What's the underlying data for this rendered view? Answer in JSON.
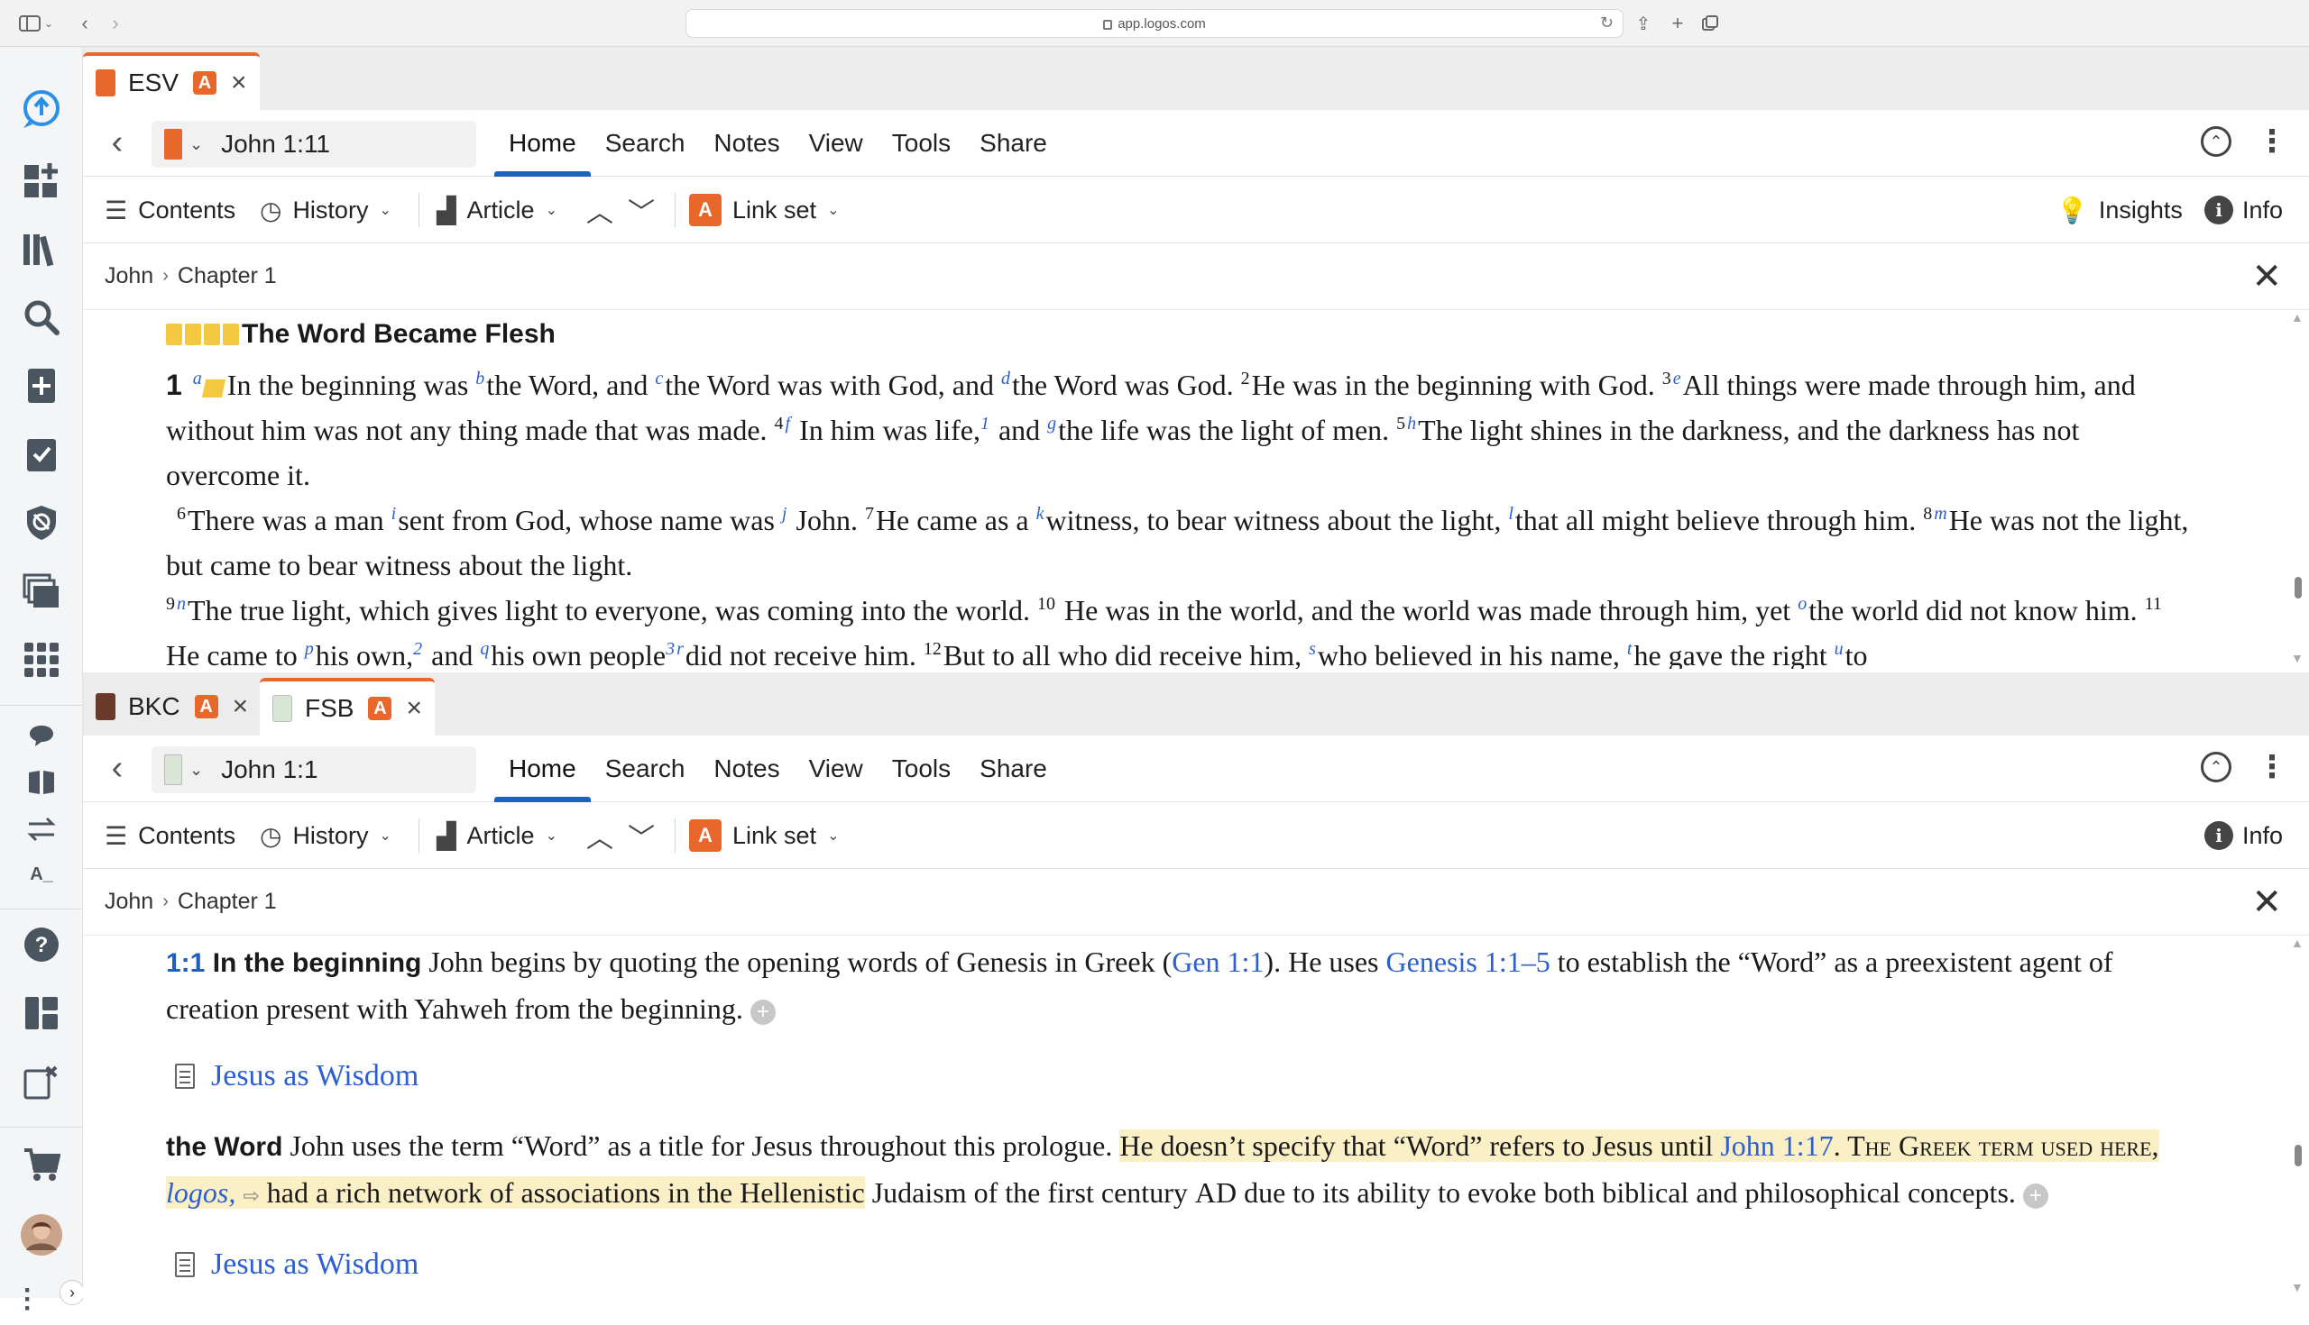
{
  "browser": {
    "url": "app.logos.com"
  },
  "top_pane": {
    "tabs": [
      {
        "label": "ESV",
        "badge": "A",
        "active": true
      }
    ],
    "reference": "John 1:11",
    "menu": [
      "Home",
      "Search",
      "Notes",
      "View",
      "Tools",
      "Share"
    ],
    "toolbar": {
      "contents": "Contents",
      "history": "History",
      "article": "Article",
      "badge": "A",
      "link_set": "Link set",
      "insights": "Insights",
      "info": "Info"
    },
    "breadcrumb": {
      "book": "John",
      "chapter": "Chapter 1"
    },
    "text": {
      "pericope": "The Word Became Flesh",
      "chapter": "1",
      "p1": [
        {
          "t": "fn",
          "v": "a"
        },
        {
          "t": "txt",
          "v": "In the beginning was "
        },
        {
          "t": "fn",
          "v": "b"
        },
        {
          "t": "txt",
          "v": "the Word, and "
        },
        {
          "t": "fn",
          "v": "c"
        },
        {
          "t": "txt",
          "v": "the Word was with God, and "
        },
        {
          "t": "fn",
          "v": "d"
        },
        {
          "t": "txt",
          "v": "the Word was God. "
        },
        {
          "t": "vn",
          "v": "2"
        },
        {
          "t": "txt",
          "v": "He was in the beginning with God. "
        },
        {
          "t": "vn",
          "v": "3"
        },
        {
          "t": "fn",
          "v": "e"
        },
        {
          "t": "txt",
          "v": "All things were made through him, and without him was not any thing made that was made. "
        },
        {
          "t": "vn",
          "v": "4"
        },
        {
          "t": "fn",
          "v": "f"
        },
        {
          "t": "txt",
          "v": " In him was life,"
        },
        {
          "t": "fn",
          "v": "1"
        },
        {
          "t": "txt",
          "v": " and "
        },
        {
          "t": "fn",
          "v": "g"
        },
        {
          "t": "txt",
          "v": "the life was the light of men. "
        },
        {
          "t": "vn",
          "v": "5"
        },
        {
          "t": "fn",
          "v": "h"
        },
        {
          "t": "txt",
          "v": "The light shines in the darkness, and the darkness has not overcome it."
        }
      ],
      "p2": [
        {
          "t": "vn",
          "v": "6"
        },
        {
          "t": "txt",
          "v": "There was a man "
        },
        {
          "t": "fn",
          "v": "i"
        },
        {
          "t": "txt",
          "v": "sent from God, whose name was "
        },
        {
          "t": "fn",
          "v": "j"
        },
        {
          "t": "txt",
          "v": " John. "
        },
        {
          "t": "vn",
          "v": "7"
        },
        {
          "t": "txt",
          "v": "He came as a "
        },
        {
          "t": "fn",
          "v": "k"
        },
        {
          "t": "txt",
          "v": "witness, to bear witness about the light, "
        },
        {
          "t": "fn",
          "v": "l"
        },
        {
          "t": "txt",
          "v": "that all might believe through him. "
        },
        {
          "t": "vn",
          "v": "8"
        },
        {
          "t": "fn",
          "v": "m"
        },
        {
          "t": "txt",
          "v": "He was not the light, but came to bear witness about the light."
        }
      ],
      "p3": [
        {
          "t": "vn",
          "v": "9"
        },
        {
          "t": "fn",
          "v": "n"
        },
        {
          "t": "txt",
          "v": "The true light, which gives light to everyone, was coming into the world. "
        },
        {
          "t": "vn",
          "v": "10"
        },
        {
          "t": "txt",
          "v": " He was in the world, and the world was made through him, yet "
        },
        {
          "t": "fn",
          "v": "o"
        },
        {
          "t": "txt",
          "v": "the world did not know him. "
        },
        {
          "t": "vn",
          "v": "11"
        },
        {
          "t": "txt",
          "v": " He came to "
        },
        {
          "t": "fn",
          "v": "p"
        },
        {
          "t": "txt",
          "v": "his own,"
        },
        {
          "t": "fn",
          "v": "2"
        },
        {
          "t": "txt",
          "v": " and "
        },
        {
          "t": "fn",
          "v": "q"
        },
        {
          "t": "txt",
          "v": "his own people"
        },
        {
          "t": "fn",
          "v": "3"
        },
        {
          "t": "fn",
          "v": "r"
        },
        {
          "t": "txt",
          "v": "did not receive him. "
        },
        {
          "t": "vn",
          "v": "12"
        },
        {
          "t": "txt",
          "v": "But to all who did receive him, "
        },
        {
          "t": "fn",
          "v": "s"
        },
        {
          "t": "txt",
          "v": "who believed in his name, "
        },
        {
          "t": "fn",
          "v": "t"
        },
        {
          "t": "txt",
          "v": "he gave the right "
        },
        {
          "t": "fn",
          "v": "u"
        },
        {
          "t": "txt",
          "v": "to"
        }
      ]
    }
  },
  "bottom_pane": {
    "tabs": [
      {
        "label": "BKC",
        "badge": "A",
        "active": false
      },
      {
        "label": "FSB",
        "badge": "A",
        "active": true
      }
    ],
    "reference": "John 1:1",
    "menu": [
      "Home",
      "Search",
      "Notes",
      "View",
      "Tools",
      "Share"
    ],
    "toolbar": {
      "contents": "Contents",
      "history": "History",
      "article": "Article",
      "badge": "A",
      "link_set": "Link set",
      "info": "Info"
    },
    "breadcrumb": {
      "book": "John",
      "chapter": "Chapter 1"
    },
    "text": {
      "lead1_ref": "1:1",
      "lead1_term": "In the beginning",
      "para1_a": " John begins by quoting the opening words of Genesis in Greek (",
      "link_gen": "Gen 1:1",
      "para1_b": "). He uses ",
      "link_gen2": "Genesis 1:1–5",
      "para1_c": " to establish the “Word” as a preexistent agent of creation present with Yahweh from the beginning.",
      "plus": "+",
      "article_link": "Jesus as Wisdom",
      "lead2_term": "the Word",
      "para2_a": " John uses the term “Word” as a title for Jesus throughout this prologue. ",
      "para2_hl1": "He doesn’t specify that “Word” refers to Jesus until ",
      "link_john": "John 1:17",
      "para2_hl2": ". The Greek term used here, ",
      "logos": "logos",
      "para2_hl3": " had a rich network of associations in the Hellenistic",
      "para2_b": " Judaism of the first century ",
      "era": "AD",
      "para2_c": " due to its ability to evoke both biblical and philosophical concepts.",
      "next_partial": "Jesus as Wisdom"
    }
  },
  "colors": {
    "accent": "#e8682c",
    "link": "#2c5fcf",
    "active_tab_underline": "#1f5fbf",
    "highlight": "#fbefc6",
    "sidebar_icon": "#4a5560",
    "sidebar_brand": "#2a8fe6"
  },
  "icons": {
    "sidebar": [
      "logos-search-icon",
      "dashboard-add-icon",
      "library-icon",
      "search-icon",
      "add-doc-icon",
      "checklist-icon",
      "shield-icon",
      "layers-icon",
      "apps-grid-icon",
      "chat-bubble-icon",
      "open-book-icon",
      "swap-arrows-icon",
      "text-size-icon",
      "help-icon",
      "layout-icon",
      "close-panels-icon",
      "cart-icon",
      "avatar",
      "more-icon",
      "expand-chevron-icon"
    ]
  }
}
